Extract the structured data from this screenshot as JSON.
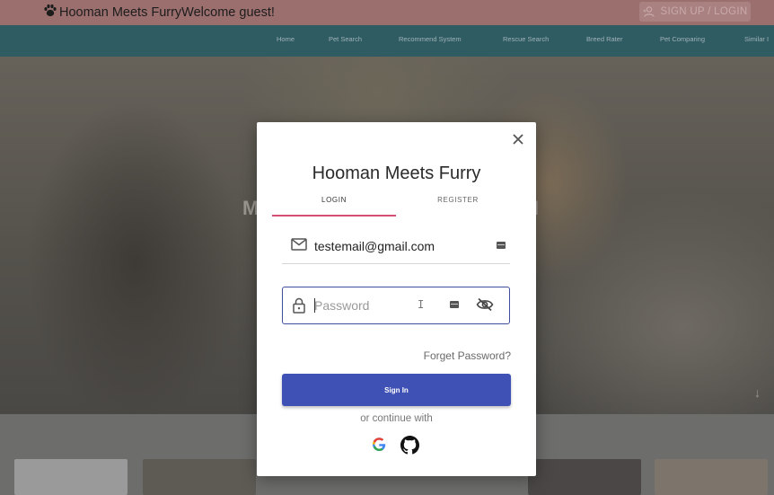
{
  "header": {
    "brand": "Hooman Meets FurryWelcome guest!",
    "brand_icon": "paw-icon",
    "auth_button": "SIGN UP / LOGIN"
  },
  "nav": {
    "items": [
      {
        "label": "Home"
      },
      {
        "label": "Pet Search"
      },
      {
        "label": "Recommend System"
      },
      {
        "label": "Rescue Search"
      },
      {
        "label": "Breed Rater"
      },
      {
        "label": "Pet Comparing"
      },
      {
        "label": "Similar I"
      }
    ]
  },
  "hero": {
    "letter_left": "M",
    "letter_right": "I"
  },
  "modal": {
    "title": "Hooman Meets Furry",
    "tabs": [
      {
        "label": "LOGIN",
        "active": true
      },
      {
        "label": "REGISTER",
        "active": false
      }
    ],
    "email": {
      "value": "testemail@gmail.com",
      "icon": "mail-icon"
    },
    "password": {
      "value": "",
      "placeholder": "Password",
      "icon": "lock-icon",
      "toggle_icon": "eye-off-icon"
    },
    "forgot_label": "Forget Password?",
    "signin_label": "Sign In",
    "continue_label": "or continue with",
    "providers": [
      "google-icon",
      "github-icon"
    ]
  },
  "colors": {
    "topbar": "#9c6f6f",
    "navbar": "#2f5b63",
    "accent_tab": "#d44f73",
    "primary_button": "#3f51b5",
    "focus_border": "#3f4f9e"
  }
}
